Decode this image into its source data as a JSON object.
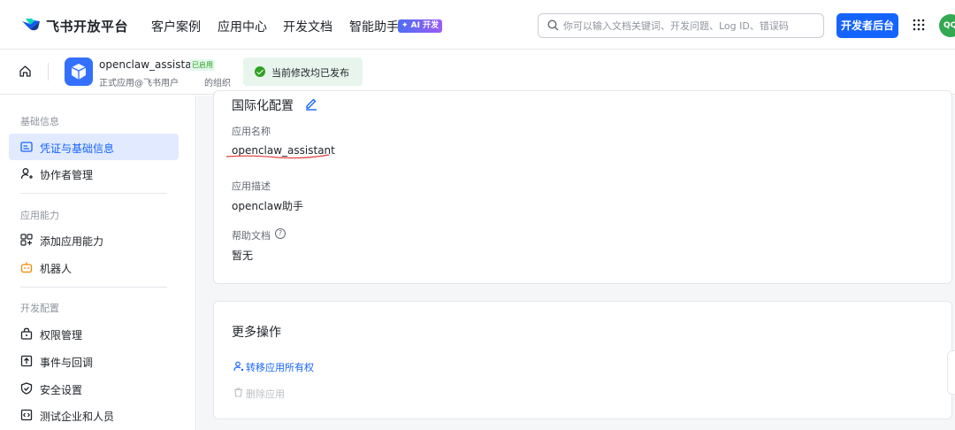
{
  "topnav": {
    "brand": "飞书开放平台",
    "links": [
      "客户案例",
      "应用中心",
      "开发文档",
      "智能助手"
    ],
    "ai_badge": "✦ AI 开发",
    "search_placeholder": "你可以输入文档关键词、开发问题、Log ID、错误码",
    "dev_console_label": "开发者后台",
    "avatar_initials": "QQ"
  },
  "subheader": {
    "app_name": "openclaw_assistant",
    "status_badge": "已启用",
    "app_type": "正式应用@飞书用户",
    "app_org": "的组织",
    "publish_notice": "当前修改均已发布"
  },
  "sidebar": {
    "groups": [
      {
        "title": "基础信息",
        "items": [
          {
            "label": "凭证与基础信息",
            "icon": "credential-icon",
            "active": true
          },
          {
            "label": "协作者管理",
            "icon": "user-add-icon"
          }
        ]
      },
      {
        "title": "应用能力",
        "items": [
          {
            "label": "添加应用能力",
            "icon": "apps-add-icon"
          },
          {
            "label": "机器人",
            "icon": "robot-icon"
          }
        ]
      },
      {
        "title": "开发配置",
        "items": [
          {
            "label": "权限管理",
            "icon": "lock-icon"
          },
          {
            "label": "事件与回调",
            "icon": "event-icon"
          },
          {
            "label": "安全设置",
            "icon": "shield-icon"
          },
          {
            "label": "测试企业和人员",
            "icon": "code-icon"
          }
        ]
      }
    ]
  },
  "i18n_card": {
    "title": "国际化配置",
    "fields": [
      {
        "label": "应用名称",
        "value": "openclaw_assistant"
      },
      {
        "label": "应用描述",
        "value": "openclaw助手"
      },
      {
        "label": "帮助文档",
        "value": "暂无"
      }
    ]
  },
  "more_card": {
    "title": "更多操作",
    "transfer_label": "转移应用所有权",
    "delete_label": "删除应用"
  },
  "colors": {
    "accent": "#1664ff",
    "success": "#2ea121",
    "annotation": "#e23b3b"
  }
}
